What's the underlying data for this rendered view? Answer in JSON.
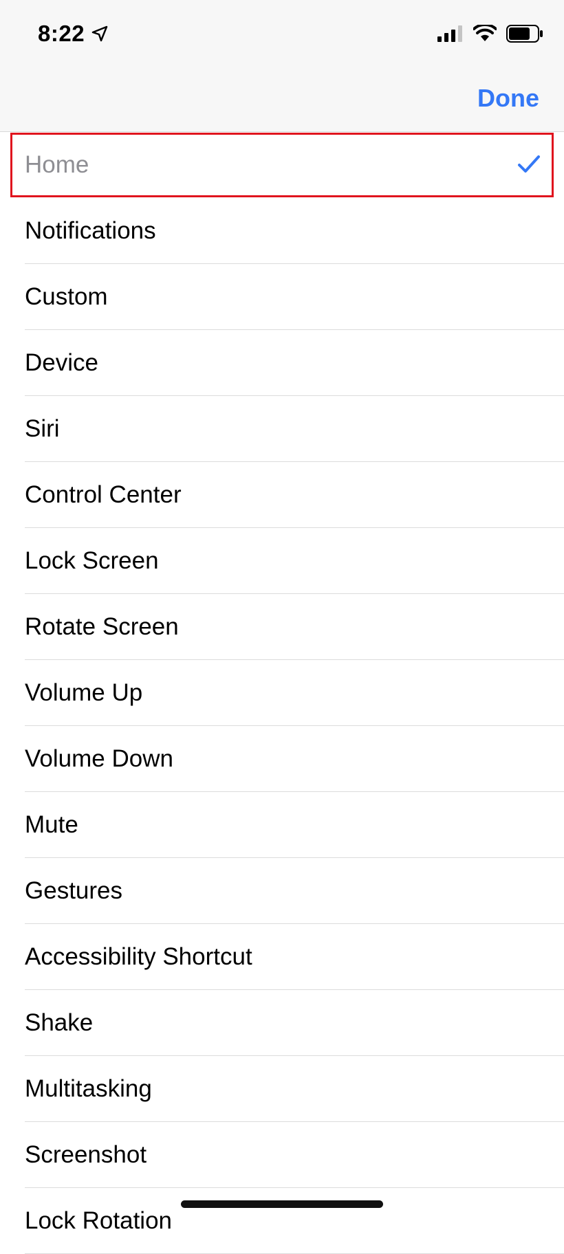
{
  "status_bar": {
    "time": "8:22",
    "icons": [
      "location-arrow-icon",
      "cellular-signal-icon",
      "wifi-icon",
      "battery-icon"
    ]
  },
  "nav": {
    "done_label": "Done"
  },
  "colors": {
    "accent": "#3478f6",
    "highlight_border": "#e0141e",
    "selected_text": "#8e8e93"
  },
  "list": {
    "items": [
      {
        "label": "Home",
        "selected": true
      },
      {
        "label": "Notifications"
      },
      {
        "label": "Custom"
      },
      {
        "label": "Device"
      },
      {
        "label": "Siri"
      },
      {
        "label": "Control Center"
      },
      {
        "label": "Lock Screen"
      },
      {
        "label": "Rotate Screen"
      },
      {
        "label": "Volume Up"
      },
      {
        "label": "Volume Down"
      },
      {
        "label": "Mute"
      },
      {
        "label": "Gestures"
      },
      {
        "label": "Accessibility Shortcut"
      },
      {
        "label": "Shake"
      },
      {
        "label": "Multitasking"
      },
      {
        "label": "Screenshot"
      },
      {
        "label": "Lock Rotation"
      }
    ]
  }
}
